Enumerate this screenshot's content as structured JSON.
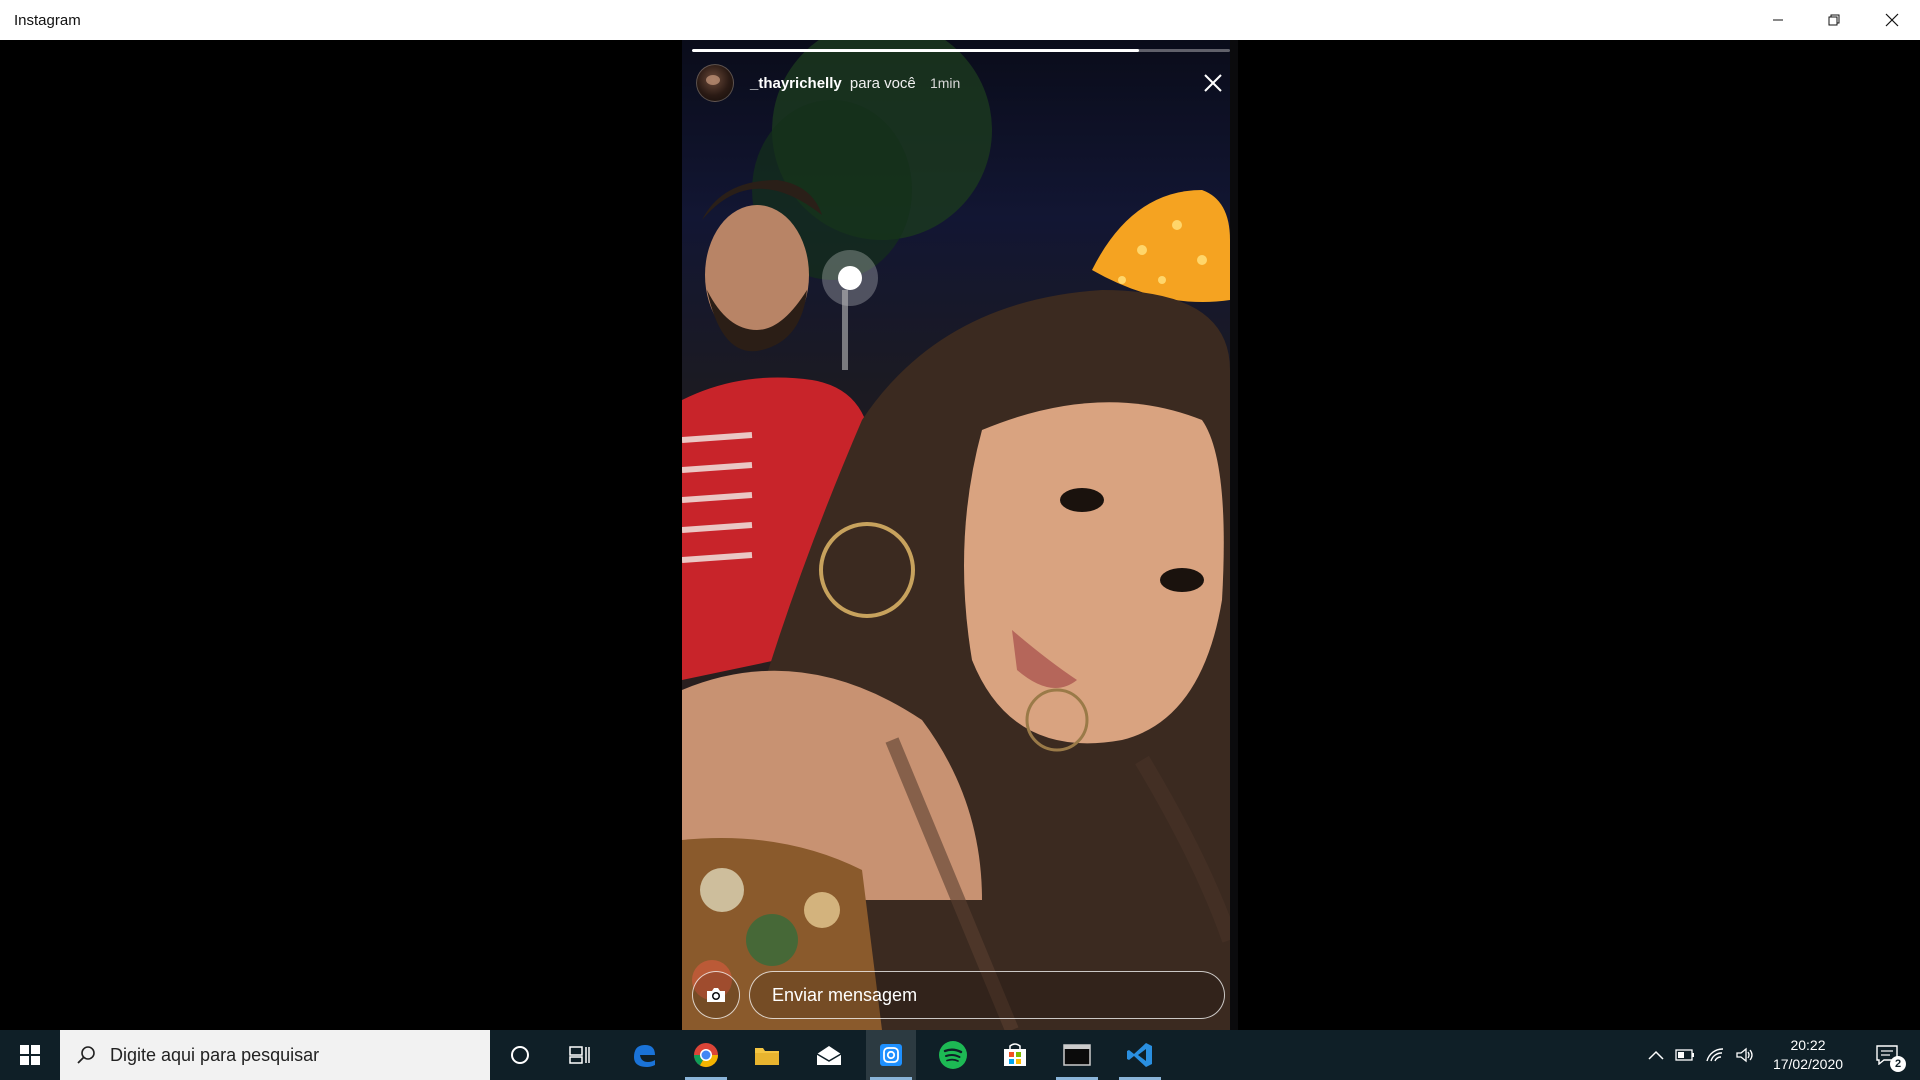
{
  "window": {
    "title": "Instagram"
  },
  "story": {
    "progress_fraction": 0.83,
    "username": "_thayrichelly",
    "audience": "para você",
    "time_ago": "1min",
    "message_placeholder": "Enviar mensagem"
  },
  "taskbar": {
    "search_placeholder": "Digite aqui para pesquisar",
    "pinned_apps": [
      "cortana-icon",
      "task-view-icon",
      "edge-icon",
      "chrome-icon",
      "file-explorer-icon",
      "mail-icon",
      "instagram-icon",
      "spotify-icon",
      "store-icon",
      "terminal-icon",
      "vscode-icon"
    ],
    "active_app": "instagram-icon",
    "clock_time": "20:22",
    "clock_date": "17/02/2020",
    "notification_count": "2"
  },
  "colors": {
    "taskbar_bg": "#0f1f27",
    "spotify_green": "#1db954",
    "edge_blue": "#1a73d8",
    "vscode_blue": "#2a8fe0"
  }
}
